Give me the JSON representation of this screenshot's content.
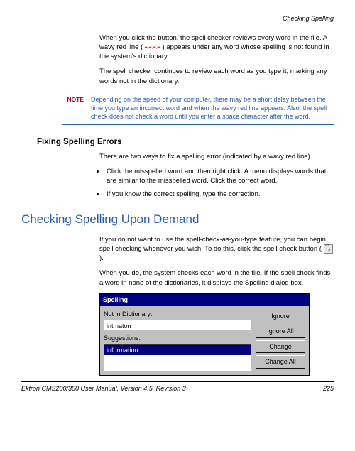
{
  "header": {
    "section": "Checking Spelling"
  },
  "intro": {
    "p1a": "When you click the button, the spell checker reviews every word in the file. A wavy red line ( ",
    "p1b": " ) appears under any word whose spelling is not found in the system's dictionary.",
    "p2": "The spell checker continues to review each word as you type it, marking any words not in the dictionary."
  },
  "note": {
    "label": "NOTE",
    "text": "Depending on the speed of your computer, there may be a short delay between the time you type an incorrect word and when the wavy red line appears. Also, the spell check does not check a word until you enter a space character after the word."
  },
  "fixing": {
    "heading": "Fixing Spelling Errors",
    "intro": "There are two ways to fix a spelling error (indicated by a wavy red line).",
    "bullets": [
      "Click the misspelled word and then right click. A menu displays words that are similar to the misspelled word. Click the correct word.",
      "If you know the correct spelling, type the correction."
    ]
  },
  "demand": {
    "heading": "Checking Spelling Upon Demand",
    "p1a": "If you do not want to use the spell-check-as-you-type feature, you can begin spell checking whenever you wish. To do this, click the spell check button ( ",
    "p1b": " ).",
    "p2": "When you do, the system checks each word in the file. If the spell check finds a word in none of the dictionaries, it displays the Spelling dialog box."
  },
  "dialog": {
    "title": "Spelling",
    "not_in_dict_label": "Not in Dictionary:",
    "not_in_dict_value": "intmaton",
    "suggestions_label": "Suggestions:",
    "suggestion_selected": "information",
    "buttons": {
      "ignore": "Ignore",
      "ignore_all": "Ignore All",
      "change": "Change",
      "change_all": "Change All"
    }
  },
  "footer": {
    "left": "Ektron CMS200/300 User Manual, Version 4.5, Revision 3",
    "page": "225"
  }
}
